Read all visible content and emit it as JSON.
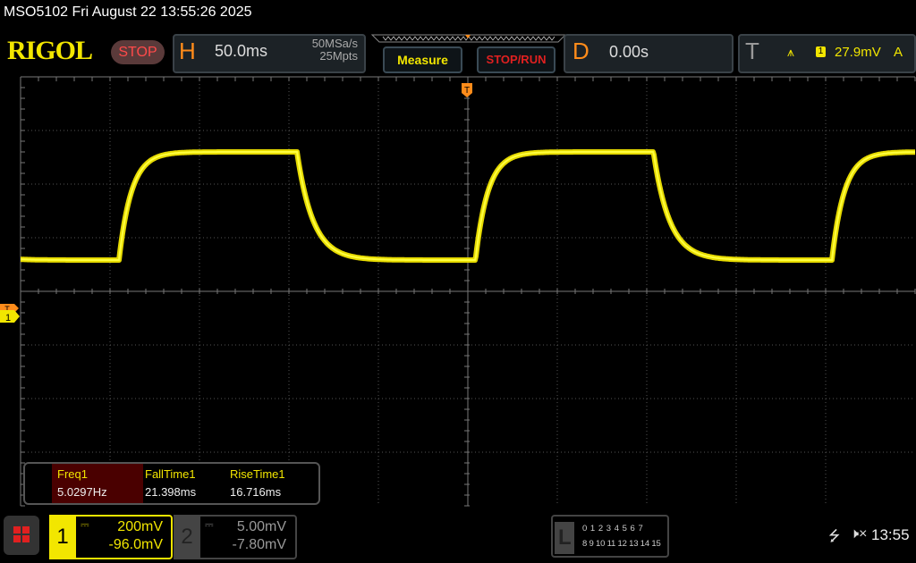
{
  "title_bar": "MSO5102  Fri August 22 13:55:26 2025",
  "logo": "RIGOL",
  "run_state": "STOP",
  "horizontal": {
    "letter": "H",
    "timebase": "50.0ms",
    "sample_rate": "50MSa/s",
    "memory_depth": "25Mpts"
  },
  "buttons": {
    "measure": "Measure",
    "stop_run": "STOP/RUN"
  },
  "delay": {
    "letter": "D",
    "value": "0.00s"
  },
  "trigger": {
    "letter": "T",
    "slope_icon": "rising-edge-icon",
    "source": "1",
    "level": "27.9mV",
    "mode": "A"
  },
  "markers": {
    "trigger_position": "T",
    "channel1": "1",
    "trigger_level": "T"
  },
  "measurements": [
    {
      "label": "Freq1",
      "value": "5.0297Hz"
    },
    {
      "label": "FallTime1",
      "value": "21.398ms"
    },
    {
      "label": "RiseTime1",
      "value": "16.716ms"
    }
  ],
  "channels": [
    {
      "num": "1",
      "scale": "200mV",
      "offset": "-96.0mV",
      "coupling_icon": "dc-coupling-icon",
      "color": "#f2e600",
      "active": true
    },
    {
      "num": "2",
      "scale": "5.00mV",
      "offset": "-7.80mV",
      "coupling_icon": "dc-coupling-icon",
      "color": "#888888",
      "active": false
    }
  ],
  "logic": {
    "letter": "L",
    "row1": "0 1 2 3  4 5 6 7",
    "row2": "8 9 10 11 12 13 14 15"
  },
  "status": {
    "usb_icon": "usb-icon",
    "mute_icon": "speaker-muted-icon",
    "clock": "13:55"
  },
  "colors": {
    "ch1": "#f2e600",
    "accent": "#ff8c1a",
    "stop": "#ff4a4a"
  }
}
